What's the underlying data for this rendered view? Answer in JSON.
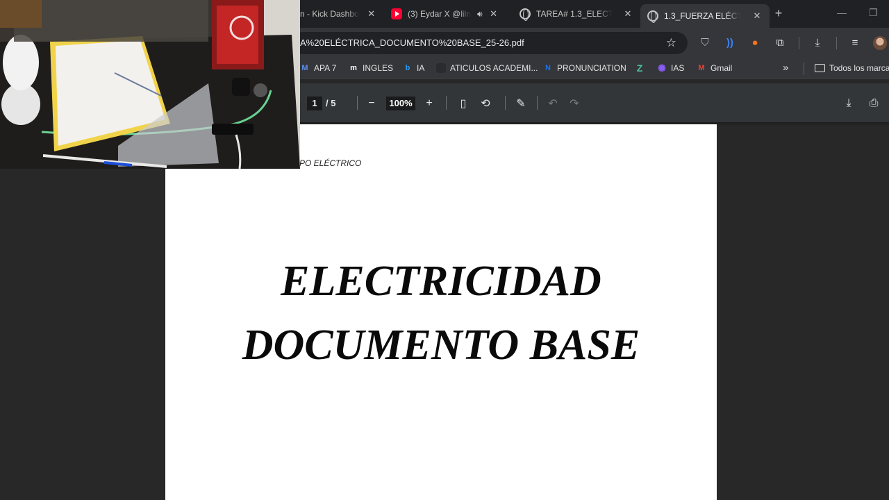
{
  "tabs": [
    {
      "label": "n - Kick Dashbo",
      "icon": "none",
      "active": false
    },
    {
      "label": "(3) Eydar X @lilne",
      "icon": "youtube-icon",
      "active": false,
      "audio": true
    },
    {
      "label": "TAREA# 1.3_ELECTRIC",
      "icon": "globe-icon",
      "active": false
    },
    {
      "label": "1.3_FUERZA ELÉCTRIC",
      "icon": "globe-icon",
      "active": true
    }
  ],
  "toolbar": {
    "url": "A%20ELÉCTRICA_DOCUMENTO%20BASE_25-26.pdf"
  },
  "bookmarks": [
    {
      "label": "APA 7",
      "icon": "mendeley-icon",
      "color": "#3b7bd8"
    },
    {
      "label": "INGLES",
      "icon": "m-logo-icon",
      "color": "#ffffff"
    },
    {
      "label": "IA",
      "icon": "bing-icon",
      "color": "#2b9af3"
    },
    {
      "label": "ATICULOS ACADEMI...",
      "icon": "blank-icon",
      "color": "#35363a"
    },
    {
      "label": "PRONUNCIATION",
      "icon": "n-logo-icon",
      "color": "#1a73e8"
    },
    {
      "label": "",
      "icon": "z-logo-icon",
      "color": "#4fbf9f"
    },
    {
      "label": "IAS",
      "icon": "gear-purple-icon",
      "color": "#8a5cf6"
    },
    {
      "label": "Gmail",
      "icon": "gmail-icon",
      "color": "#ea4335"
    }
  ],
  "bookmarks_overflow": "»",
  "all_bookmarks": "Todos los marca",
  "pdf": {
    "current_page": "1",
    "total_pages": "/ 5",
    "zoom": "100%"
  },
  "document": {
    "header": "PO ELÉCTRICO",
    "title_line1": "ELECTRICIDAD",
    "title_line2": "DOCUMENTO BASE"
  },
  "colors": {
    "tab_strip": "#202124",
    "toolbar": "#35363a",
    "pdf_toolbar": "#323639",
    "viewer_background": "#282828",
    "page": "#ffffff"
  }
}
